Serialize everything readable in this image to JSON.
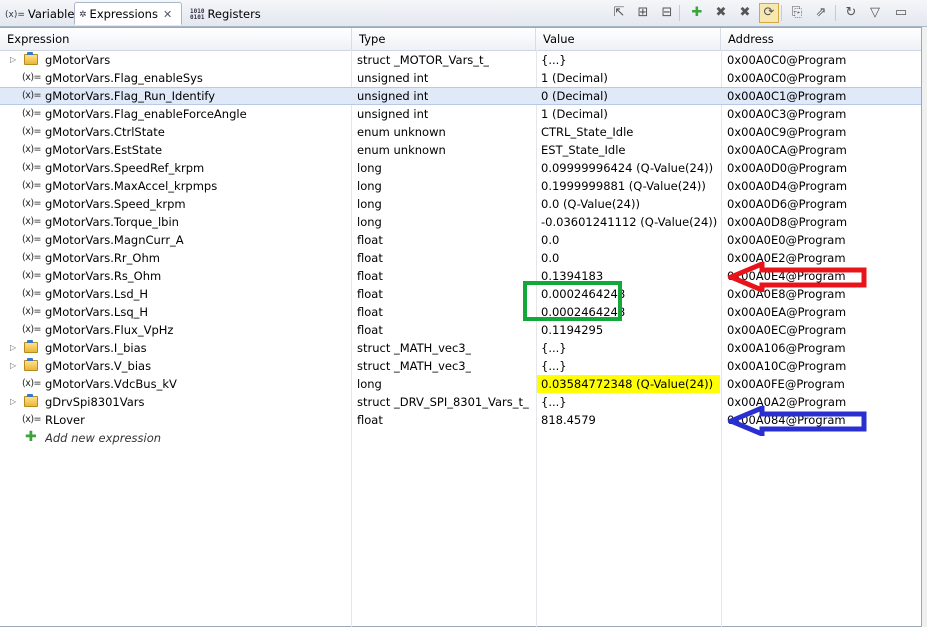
{
  "tabs": [
    {
      "icon": "(x)=",
      "label": "Variables",
      "active": false
    },
    {
      "icon": "(x)=",
      "label": "Expressions",
      "active": true,
      "close": "✕"
    },
    {
      "icon": "1010\n0101",
      "label": "Registers",
      "active": false
    }
  ],
  "toolbar": {
    "buttons": [
      {
        "name": "collapse-all-icon",
        "glyph": "⇱"
      },
      {
        "name": "show-type-names-icon",
        "glyph": "⊞"
      },
      {
        "name": "collapse-icon",
        "glyph": "⊟"
      },
      {
        "name": "add-expression-icon",
        "glyph": "✚"
      },
      {
        "name": "remove-expression-icon",
        "glyph": "✖"
      },
      {
        "name": "remove-all-icon",
        "glyph": "✖"
      },
      {
        "name": "continuous-refresh-icon",
        "glyph": "⟳"
      },
      {
        "name": "new-view-icon",
        "glyph": "⎘"
      },
      {
        "name": "export-icon",
        "glyph": "⇗"
      },
      {
        "name": "refresh-icon",
        "glyph": "↻"
      },
      {
        "name": "view-menu-icon",
        "glyph": "▽"
      },
      {
        "name": "minimize-icon",
        "glyph": "▭"
      }
    ]
  },
  "columns": [
    "Expression",
    "Type",
    "Value",
    "Address"
  ],
  "rows": [
    {
      "kind": "struct",
      "expandable": true,
      "expression": "gMotorVars",
      "type": "struct _MOTOR_Vars_t_",
      "value": "{...}",
      "address": "0x00A0C0@Program"
    },
    {
      "kind": "var",
      "expression": "gMotorVars.Flag_enableSys",
      "type": "unsigned int",
      "value": "1 (Decimal)",
      "address": "0x00A0C0@Program"
    },
    {
      "kind": "var",
      "selected": true,
      "expression": "gMotorVars.Flag_Run_Identify",
      "type": "unsigned int",
      "value": "0 (Decimal)",
      "address": "0x00A0C1@Program"
    },
    {
      "kind": "var",
      "expression": "gMotorVars.Flag_enableForceAngle",
      "type": "unsigned int",
      "value": "1 (Decimal)",
      "address": "0x00A0C3@Program"
    },
    {
      "kind": "var",
      "expression": "gMotorVars.CtrlState",
      "type": "enum unknown",
      "value": "CTRL_State_Idle",
      "address": "0x00A0C9@Program"
    },
    {
      "kind": "var",
      "expression": "gMotorVars.EstState",
      "type": "enum unknown",
      "value": "EST_State_Idle",
      "address": "0x00A0CA@Program"
    },
    {
      "kind": "var",
      "expression": "gMotorVars.SpeedRef_krpm",
      "type": "long",
      "value": "0.09999996424 (Q-Value(24))",
      "address": "0x00A0D0@Program"
    },
    {
      "kind": "var",
      "expression": "gMotorVars.MaxAccel_krpmps",
      "type": "long",
      "value": "0.1999999881 (Q-Value(24))",
      "address": "0x00A0D4@Program"
    },
    {
      "kind": "var",
      "expression": "gMotorVars.Speed_krpm",
      "type": "long",
      "value": "0.0 (Q-Value(24))",
      "address": "0x00A0D6@Program"
    },
    {
      "kind": "var",
      "expression": "gMotorVars.Torque_lbin",
      "type": "long",
      "value": "-0.03601241112 (Q-Value(24))",
      "address": "0x00A0D8@Program"
    },
    {
      "kind": "var",
      "expression": "gMotorVars.MagnCurr_A",
      "type": "float",
      "value": "0.0",
      "address": "0x00A0E0@Program"
    },
    {
      "kind": "var",
      "expression": "gMotorVars.Rr_Ohm",
      "type": "float",
      "value": "0.0",
      "address": "0x00A0E2@Program"
    },
    {
      "kind": "var",
      "expression": "gMotorVars.Rs_Ohm",
      "type": "float",
      "value": "0.1394183",
      "address": "0x00A0E4@Program"
    },
    {
      "kind": "var",
      "expression": "gMotorVars.Lsd_H",
      "type": "float",
      "value": "0.0002464248",
      "address": "0x00A0E8@Program"
    },
    {
      "kind": "var",
      "expression": "gMotorVars.Lsq_H",
      "type": "float",
      "value": "0.0002464248",
      "address": "0x00A0EA@Program"
    },
    {
      "kind": "var",
      "expression": "gMotorVars.Flux_VpHz",
      "type": "float",
      "value": "0.1194295",
      "address": "0x00A0EC@Program"
    },
    {
      "kind": "struct",
      "expandable": true,
      "expression": "gMotorVars.I_bias",
      "type": "struct _MATH_vec3_",
      "value": "{...}",
      "address": "0x00A106@Program"
    },
    {
      "kind": "struct",
      "expandable": true,
      "expression": "gMotorVars.V_bias",
      "type": "struct _MATH_vec3_",
      "value": "{...}",
      "address": "0x00A10C@Program"
    },
    {
      "kind": "var",
      "highlight": "#ffff00",
      "expression": "gMotorVars.VdcBus_kV",
      "type": "long",
      "value": "0.03584772348 (Q-Value(24))",
      "address": "0x00A0FE@Program"
    },
    {
      "kind": "struct",
      "expandable": true,
      "expression": "gDrvSpi8301Vars",
      "type": "struct _DRV_SPI_8301_Vars_t_",
      "value": "{...}",
      "address": "0x00A0A2@Program"
    },
    {
      "kind": "var",
      "expression": "RLover",
      "type": "float",
      "value": "818.4579",
      "address": "0x00A084@Program"
    },
    {
      "kind": "add",
      "expression": "Add new expression",
      "type": "",
      "value": "",
      "address": ""
    }
  ],
  "annotations": {
    "red_arrow_color": "#e8141b",
    "blue_arrow_color": "#2a2fd0",
    "green_box_color": "#13a83a"
  }
}
